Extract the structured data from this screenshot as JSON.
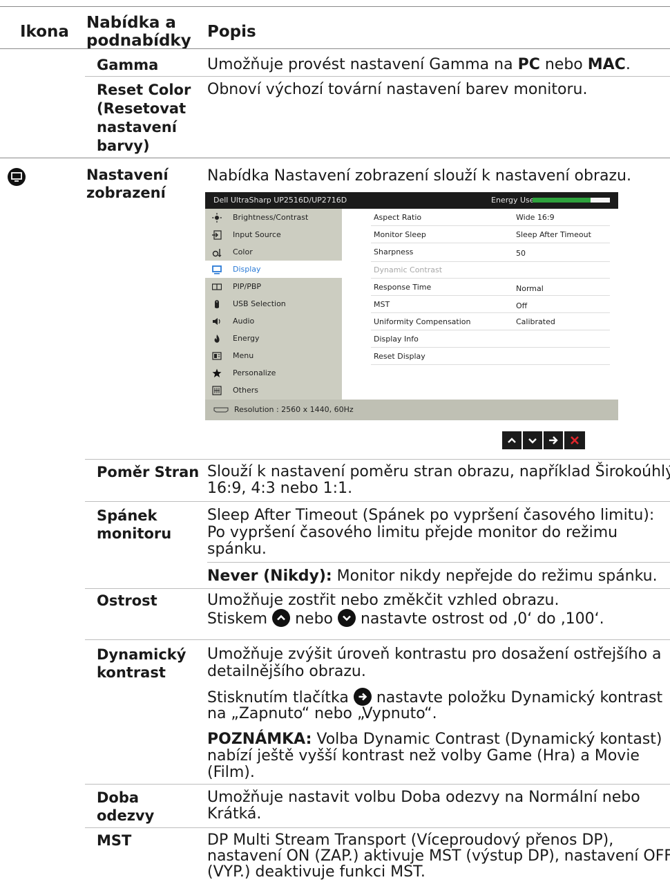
{
  "header": {
    "col_icon": "Ikona",
    "col_menu": "Nabídka a podnabídky",
    "col_desc": "Popis"
  },
  "rows": {
    "gamma": {
      "label": "Gamma",
      "desc_pre": "Umožňuje provést nastavení Gamma na ",
      "pc": "PC",
      "mid": " nebo ",
      "mac": "MAC",
      "post": "."
    },
    "reset_color": {
      "label_lines": [
        "Reset Color",
        "(Resetovat",
        "nastavení",
        "barvy)"
      ],
      "desc": "Obnoví výchozí tovární nastavení barev monitoru."
    },
    "display": {
      "label_lines": [
        "Nastavení",
        "zobrazení"
      ],
      "desc": "Nabídka Nastavení zobrazení slouží k nastavení obrazu.",
      "icon": "monitor-icon"
    },
    "aspect": {
      "label": "Poměr Stran",
      "desc_lines": [
        "Slouží k nastavení poměru stran obrazu, například Širokoúhlý",
        "16:9, 4:3 nebo 1:1."
      ]
    },
    "sleep": {
      "label_lines": [
        "Spánek",
        "monitoru"
      ],
      "desc_lines": [
        "Sleep After Timeout (Spánek po vypršení časového limitu):",
        "Po vypršení časového limitu přejde monitor do režimu",
        "spánku."
      ],
      "never_bold": "Never (Nikdy):",
      "never_text": " Monitor nikdy nepřejde do režimu spánku."
    },
    "sharpness": {
      "label": "Ostrost",
      "line1": "Umožňuje zostřit nebo změkčit vzhled obrazu.",
      "pre": "Stiskem ",
      "mid": " nebo ",
      "post": " nastavte ostrost od ‚0‘ do ‚100‘."
    },
    "dyncontrast": {
      "label_lines": [
        "Dynamický",
        "kontrast"
      ],
      "desc_lines": [
        "Umožňuje zvýšit úroveň kontrastu pro dosažení ostřejšího a",
        "detailnějšího obrazu."
      ],
      "p2_pre": "Stisknutím tlačítka ",
      "p2_post": " nastavte položku Dynamický kontrast",
      "p2_line2": "na „Zapnuto“ nebo „Vypnuto“.",
      "note_bold": "POZNÁMKA:",
      "note_text": " Volba Dynamic Contrast (Dynamický kontast)",
      "note_lines": [
        "nabízí ještě vyšší kontrast než volby Game (Hra) a Movie",
        "(Film)."
      ]
    },
    "response": {
      "label_lines": [
        "Doba",
        "odezvy"
      ],
      "desc_lines": [
        "Umožňuje nastavit volbu Doba odezvy na Normální nebo",
        "Krátká."
      ]
    },
    "mst": {
      "label": "MST",
      "desc_lines": [
        "DP Multi Stream Transport (Víceproudový přenos DP),",
        "nastavení ON (ZAP.) aktivuje MST (výstup DP), nastavení OFF",
        "(VYP.) deaktivuje funkci MST."
      ]
    }
  },
  "osd": {
    "title": "Dell UltraSharp UP2516D/UP2716D",
    "energy_label": "Energy Use",
    "energy_level": 0.75,
    "menu": [
      {
        "label": "Brightness/Contrast",
        "icon": "brightness-icon",
        "selected": false
      },
      {
        "label": "Input Source",
        "icon": "input-source-icon",
        "selected": false
      },
      {
        "label": "Color",
        "icon": "color-icon",
        "selected": false
      },
      {
        "label": "Display",
        "icon": "display-icon",
        "selected": true
      },
      {
        "label": "PIP/PBP",
        "icon": "pip-icon",
        "selected": false
      },
      {
        "label": "USB Selection",
        "icon": "usb-icon",
        "selected": false
      },
      {
        "label": "Audio",
        "icon": "audio-icon",
        "selected": false
      },
      {
        "label": "Energy",
        "icon": "energy-icon",
        "selected": false
      },
      {
        "label": "Menu",
        "icon": "menu-icon",
        "selected": false
      },
      {
        "label": "Personalize",
        "icon": "star-icon",
        "selected": false
      },
      {
        "label": "Others",
        "icon": "others-icon",
        "selected": false
      }
    ],
    "settings": [
      {
        "key": "Aspect Ratio",
        "value": "Wide 16:9",
        "dim": false
      },
      {
        "key": "Monitor Sleep",
        "value": "Sleep After Timeout",
        "dim": false
      },
      {
        "key": "Sharpness",
        "value": "50",
        "dim": false
      },
      {
        "key": "Dynamic Contrast",
        "value": "",
        "dim": true
      },
      {
        "key": "Response Time",
        "value": "Normal",
        "dim": false
      },
      {
        "key": "MST",
        "value": "Off",
        "dim": false
      },
      {
        "key": "Uniformity Compensation",
        "value": "Calibrated",
        "dim": false
      },
      {
        "key": "Display Info",
        "value": "",
        "dim": false
      },
      {
        "key": "Reset Display",
        "value": "",
        "dim": false
      }
    ],
    "footer": "Resolution : 2560 x 1440, 60Hz",
    "nav_buttons": [
      "up-button",
      "down-button",
      "enter-button",
      "exit-button"
    ]
  },
  "colors": {
    "osd_dark": "#1b1b1b",
    "osd_menu_bg": "#cccdc1",
    "osd_accent": "#2a7ad6",
    "energy_green": "#2ea23d",
    "exit_red": "#e0262b"
  }
}
